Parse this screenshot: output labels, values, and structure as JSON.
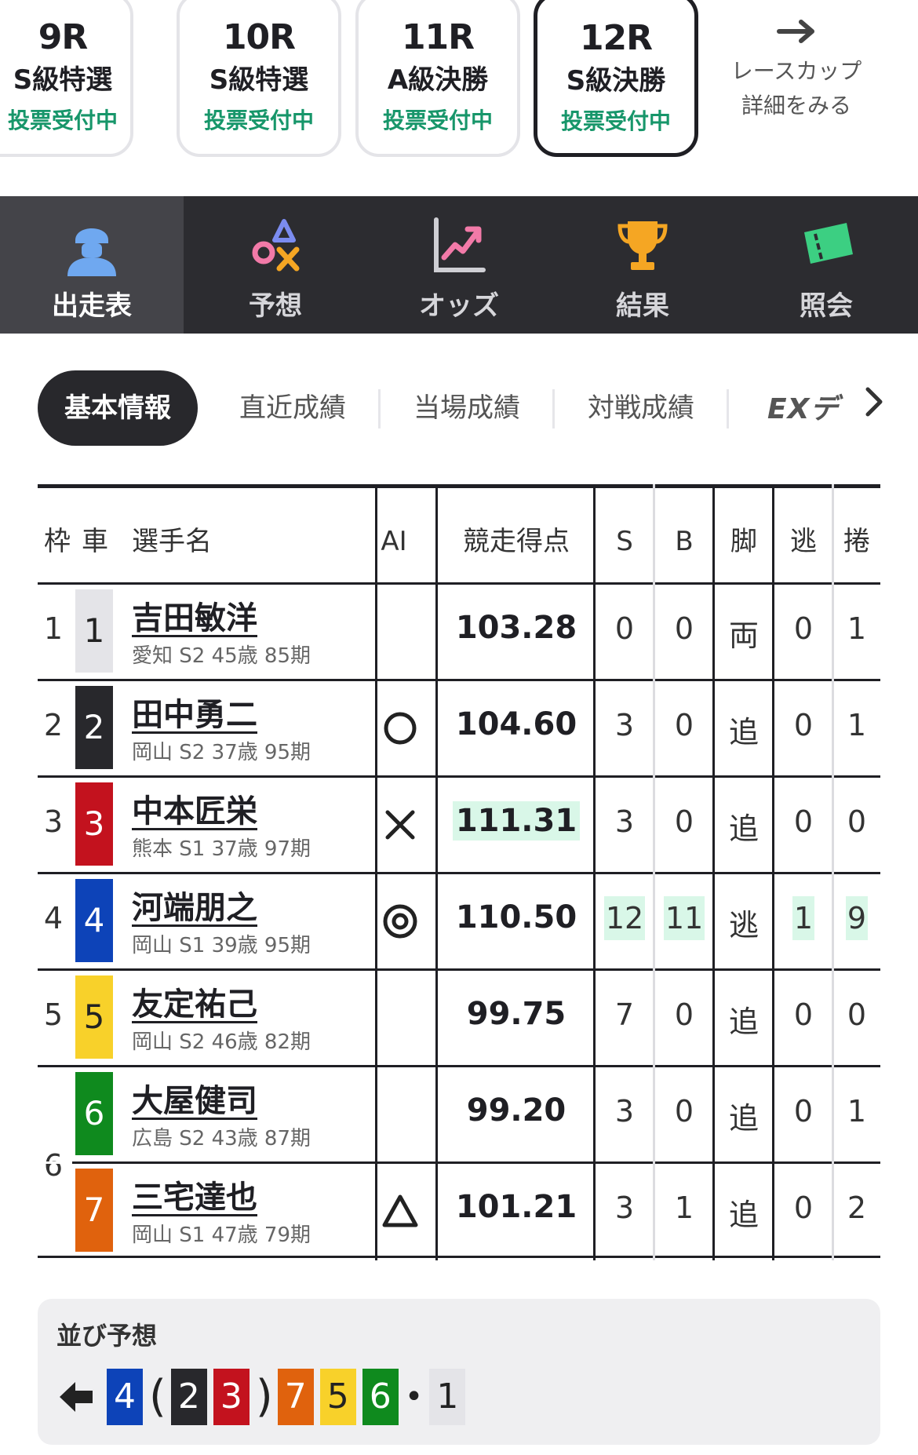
{
  "race_tabs": [
    {
      "race": "9R",
      "grade": "S級特選",
      "status": "投票受付中",
      "active": false
    },
    {
      "race": "10R",
      "grade": "S級特選",
      "status": "投票受付中",
      "active": false
    },
    {
      "race": "11R",
      "grade": "A級決勝",
      "status": "投票受付中",
      "active": false
    },
    {
      "race": "12R",
      "grade": "S級決勝",
      "status": "投票受付中",
      "active": true
    }
  ],
  "cup_link": {
    "line1": "レースカップ",
    "line2": "詳細をみる"
  },
  "main_nav": [
    {
      "label": "出走表",
      "icon": "rider-helmet-icon",
      "active": true
    },
    {
      "label": "予想",
      "icon": "prediction-marks-icon",
      "active": false
    },
    {
      "label": "オッズ",
      "icon": "odds-chart-icon",
      "active": false
    },
    {
      "label": "結果",
      "icon": "trophy-icon",
      "active": false
    },
    {
      "label": "照会",
      "icon": "ticket-icon",
      "active": false
    }
  ],
  "sub_tabs": {
    "active": "基本情報",
    "items": [
      "直近成績",
      "当場成績",
      "対戦成績"
    ],
    "ext": "EXデ"
  },
  "table": {
    "headers": {
      "waku": "枠",
      "car": "車",
      "name": "選手名",
      "ai": "AI",
      "score": "競走得点",
      "s": "S",
      "b": "B",
      "leg": "脚",
      "nige": "逃",
      "makuri": "捲"
    },
    "rows": [
      {
        "waku": "1",
        "car": "1",
        "name": "吉田敏洋",
        "meta": "愛知 S2 45歳 85期",
        "ai": "",
        "score": "103.28",
        "s": "0",
        "b": "0",
        "leg": "両",
        "nige": "0",
        "makuri": "1"
      },
      {
        "waku": "2",
        "car": "2",
        "name": "田中勇二",
        "meta": "岡山 S2 37歳 95期",
        "ai": "circle",
        "score": "104.60",
        "s": "3",
        "b": "0",
        "leg": "追",
        "nige": "0",
        "makuri": "1"
      },
      {
        "waku": "3",
        "car": "3",
        "name": "中本匠栄",
        "meta": "熊本 S1 37歳 97期",
        "ai": "cross",
        "score": "111.31",
        "s": "3",
        "b": "0",
        "leg": "追",
        "nige": "0",
        "makuri": "0"
      },
      {
        "waku": "4",
        "car": "4",
        "name": "河端朋之",
        "meta": "岡山 S1 39歳 95期",
        "ai": "double-circle",
        "score": "110.50",
        "s": "12",
        "b": "11",
        "leg": "逃",
        "nige": "1",
        "makuri": "9"
      },
      {
        "waku": "5",
        "car": "5",
        "name": "友定祐己",
        "meta": "岡山 S2 46歳 82期",
        "ai": "",
        "score": "99.75",
        "s": "7",
        "b": "0",
        "leg": "追",
        "nige": "0",
        "makuri": "0"
      },
      {
        "waku": "6",
        "car": "6",
        "name": "大屋健司",
        "meta": "広島 S2 43歳 87期",
        "ai": "",
        "score": "99.20",
        "s": "3",
        "b": "0",
        "leg": "追",
        "nige": "0",
        "makuri": "1"
      },
      {
        "waku": "",
        "car": "7",
        "name": "三宅達也",
        "meta": "岡山 S1 47歳 79期",
        "ai": "triangle",
        "score": "101.21",
        "s": "3",
        "b": "1",
        "leg": "追",
        "nige": "0",
        "makuri": "2"
      }
    ]
  },
  "car_colors": {
    "1": {
      "bg": "#e4e4e8",
      "fg": "#222222"
    },
    "2": {
      "bg": "#28282c",
      "fg": "#ffffff"
    },
    "3": {
      "bg": "#c3121e",
      "fg": "#ffffff"
    },
    "4": {
      "bg": "#0d43b8",
      "fg": "#ffffff"
    },
    "5": {
      "bg": "#f8d12a",
      "fg": "#222222"
    },
    "6": {
      "bg": "#0f8a1e",
      "fg": "#ffffff"
    },
    "7": {
      "bg": "#e0620d",
      "fg": "#ffffff"
    }
  },
  "formation": {
    "title": "並び予想",
    "sequence": [
      "4",
      "(",
      "2",
      "3",
      ")",
      "7",
      "5",
      "6",
      "•",
      "1"
    ]
  }
}
